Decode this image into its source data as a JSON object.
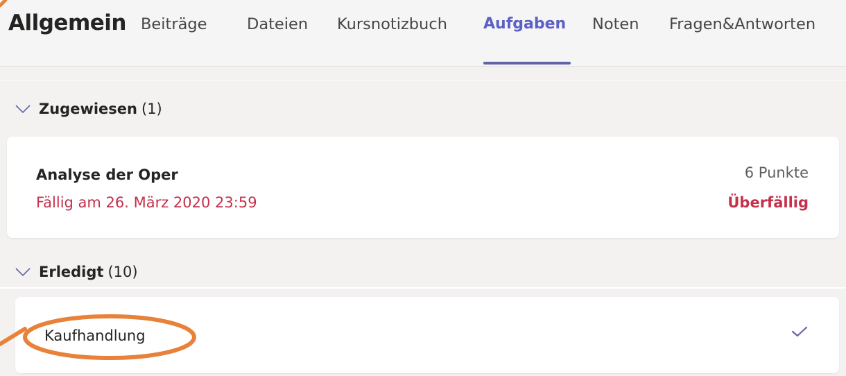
{
  "header": {
    "channel_title": "Allgemein",
    "tabs": [
      {
        "label": "Beiträge"
      },
      {
        "label": "Dateien"
      },
      {
        "label": "Kursnotizbuch"
      },
      {
        "label": "Aufgaben",
        "active": true
      },
      {
        "label": "Noten"
      },
      {
        "label": "Fragen&Antworten"
      }
    ]
  },
  "sections": {
    "assigned": {
      "title": "Zugewiesen",
      "count": "(1)",
      "items": [
        {
          "title": "Analyse der Oper",
          "due": "Fällig am 26. März 2020 23:59",
          "points": "6 Punkte",
          "status": "Überfällig"
        }
      ]
    },
    "done": {
      "title": "Erledigt",
      "count": "(10)",
      "items": [
        {
          "title": "Kaufhandlung",
          "completed": true
        }
      ]
    }
  },
  "icons": {
    "chevron": "chevron-down-icon",
    "check": "checkmark-icon"
  },
  "colors": {
    "accent": "#6264a7",
    "overdue": "#c4314b",
    "annotation": "#e8823a"
  }
}
